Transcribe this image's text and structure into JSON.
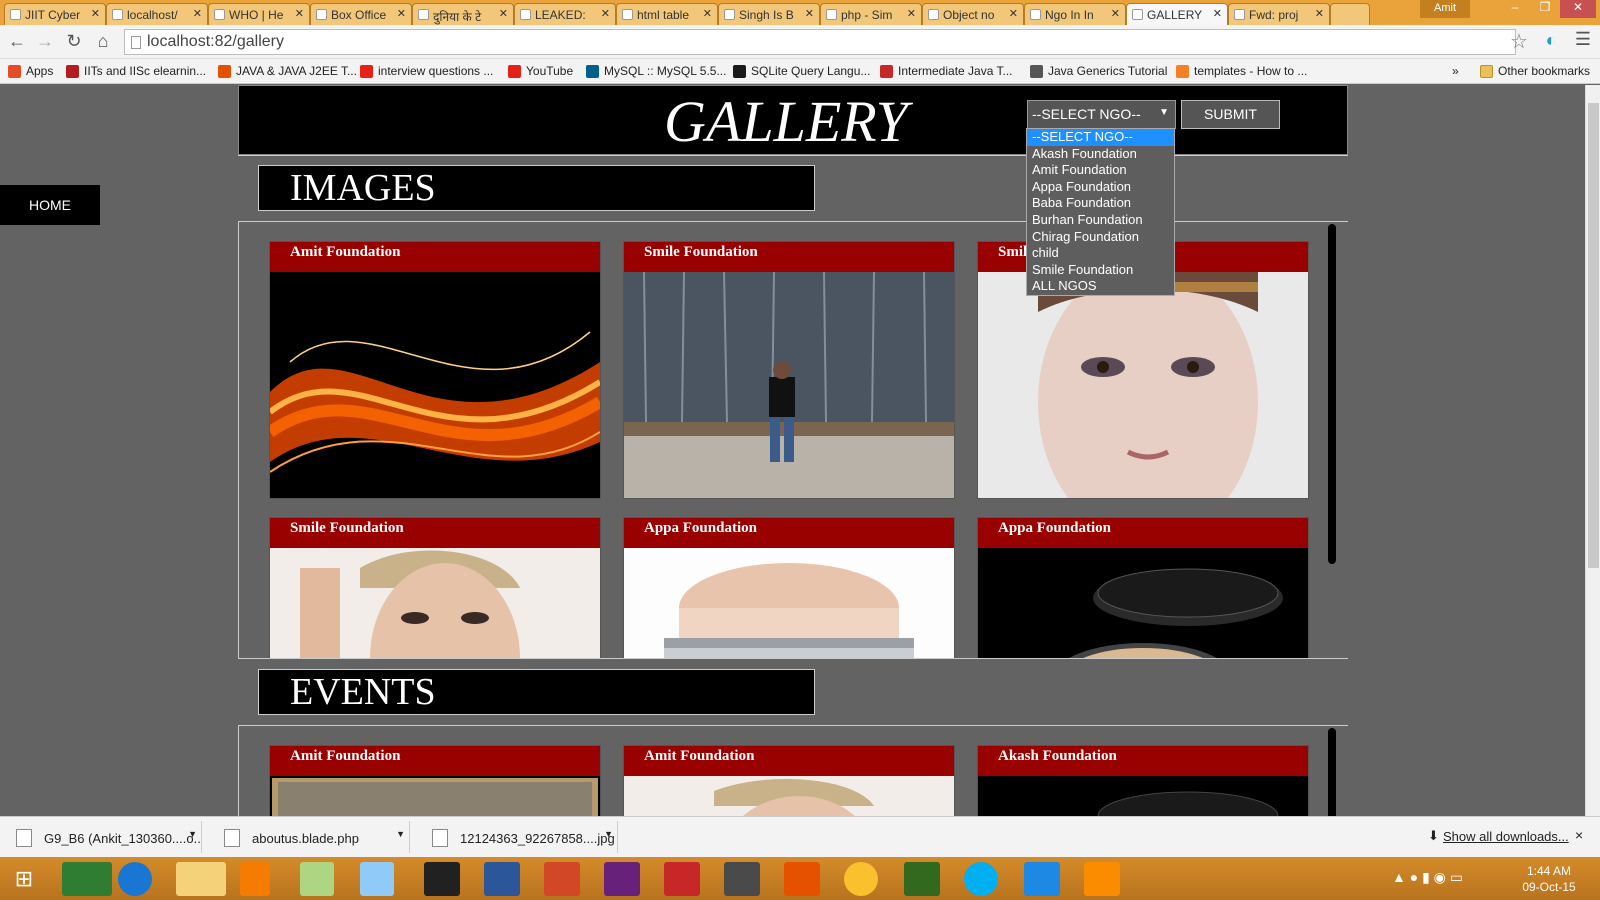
{
  "browser": {
    "tabs": [
      {
        "label": "JIIT Cyber"
      },
      {
        "label": "localhost/"
      },
      {
        "label": "WHO | He"
      },
      {
        "label": "Box Office"
      },
      {
        "label": "दुनिया के टे"
      },
      {
        "label": "LEAKED: "
      },
      {
        "label": "html table"
      },
      {
        "label": "Singh Is B"
      },
      {
        "label": "php - Sim"
      },
      {
        "label": "Object no"
      },
      {
        "label": "Ngo In In"
      },
      {
        "label": "GALLERY",
        "active": true
      },
      {
        "label": "Fwd: proj"
      }
    ],
    "user": "Amit",
    "url": "localhost:82/gallery",
    "bookmarks": [
      {
        "label": "Apps",
        "color": "#e44d26"
      },
      {
        "label": "IITs and IISc elearnin...",
        "color": "#b71c1c"
      },
      {
        "label": "JAVA & JAVA J2EE T...",
        "color": "#e65100"
      },
      {
        "label": "interview questions ...",
        "color": "#e62117"
      },
      {
        "label": "YouTube",
        "color": "#e62117"
      },
      {
        "label": "MySQL :: MySQL 5.5...",
        "color": "#00618a"
      },
      {
        "label": "SQLite Query Langu...",
        "color": "#1a1a1a"
      },
      {
        "label": "Intermediate Java T...",
        "color": "#c62828"
      },
      {
        "label": "Java Generics Tutorial",
        "color": "#555555"
      },
      {
        "label": "templates - How to ...",
        "color": "#f48024"
      }
    ],
    "other_bookmarks": "Other bookmarks",
    "more": "»"
  },
  "page": {
    "home_label": "HOME",
    "title": "GALLERY",
    "select": {
      "value": "--SELECT NGO--",
      "options": [
        "--SELECT NGO--",
        "Akash Foundation",
        "Amit Foundation",
        "Appa Foundation",
        "Baba Foundation",
        "Burhan Foundation",
        "Chirag Foundation",
        "child",
        "Smile Foundation",
        "ALL NGOS"
      ]
    },
    "submit_label": "SUBMIT",
    "images_heading": "IMAGES",
    "events_heading": "EVENTS",
    "images": [
      {
        "caption": "Amit Foundation",
        "kind": "orange-wave"
      },
      {
        "caption": "Smile Foundation",
        "kind": "waterfall-person"
      },
      {
        "caption": "Smile Foundation",
        "kind": "face-portrait"
      },
      {
        "caption": "Smile Foundation",
        "kind": "woman-cap"
      },
      {
        "caption": "Appa Foundation",
        "kind": "cream-jar"
      },
      {
        "caption": "Appa Foundation",
        "kind": "compact-powder"
      }
    ],
    "events": [
      {
        "caption": "Amit Foundation"
      },
      {
        "caption": "Amit Foundation"
      },
      {
        "caption": "Akash Foundation"
      }
    ]
  },
  "downloads": {
    "items": [
      {
        "label": "G9_B6 (Ankit_130360....o..."
      },
      {
        "label": "aboutus.blade.php"
      },
      {
        "label": "12124363_92267858....jpg"
      }
    ],
    "show_all": "Show all downloads...",
    "close": "×"
  },
  "taskbar": {
    "time": "1:44 AM",
    "date": "09-Oct-15"
  }
}
